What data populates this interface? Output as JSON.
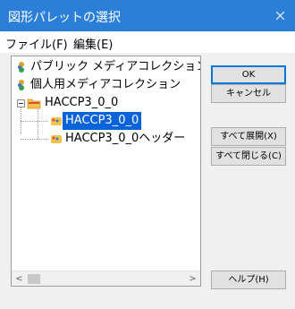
{
  "window": {
    "title": "図形パレットの選択",
    "close_icon": "close-icon",
    "titlebar_color": "#2b7fd9"
  },
  "menu": {
    "file": "ファイル(F)",
    "edit": "編集(E)"
  },
  "tree": {
    "items": [
      {
        "label": "パブリック メディアコレクション",
        "icon": "collection-icon"
      },
      {
        "label": "個人用メディアコレクション",
        "icon": "collection-icon"
      },
      {
        "label": "HACCP3_0_0",
        "icon": "folder-icon",
        "expanded": true
      },
      {
        "label": "HACCP3_0_0",
        "icon": "palette-icon",
        "selected": true
      },
      {
        "label": "HACCP3_0_0ヘッダー",
        "icon": "palette-icon"
      }
    ],
    "selection_color": "#0a63d8"
  },
  "buttons": {
    "ok": "OK",
    "cancel": "キャンセル",
    "expand_all": "すべて展開(X)",
    "collapse_all": "すべて閉じる(C)",
    "help": "ヘルプ(H)"
  }
}
